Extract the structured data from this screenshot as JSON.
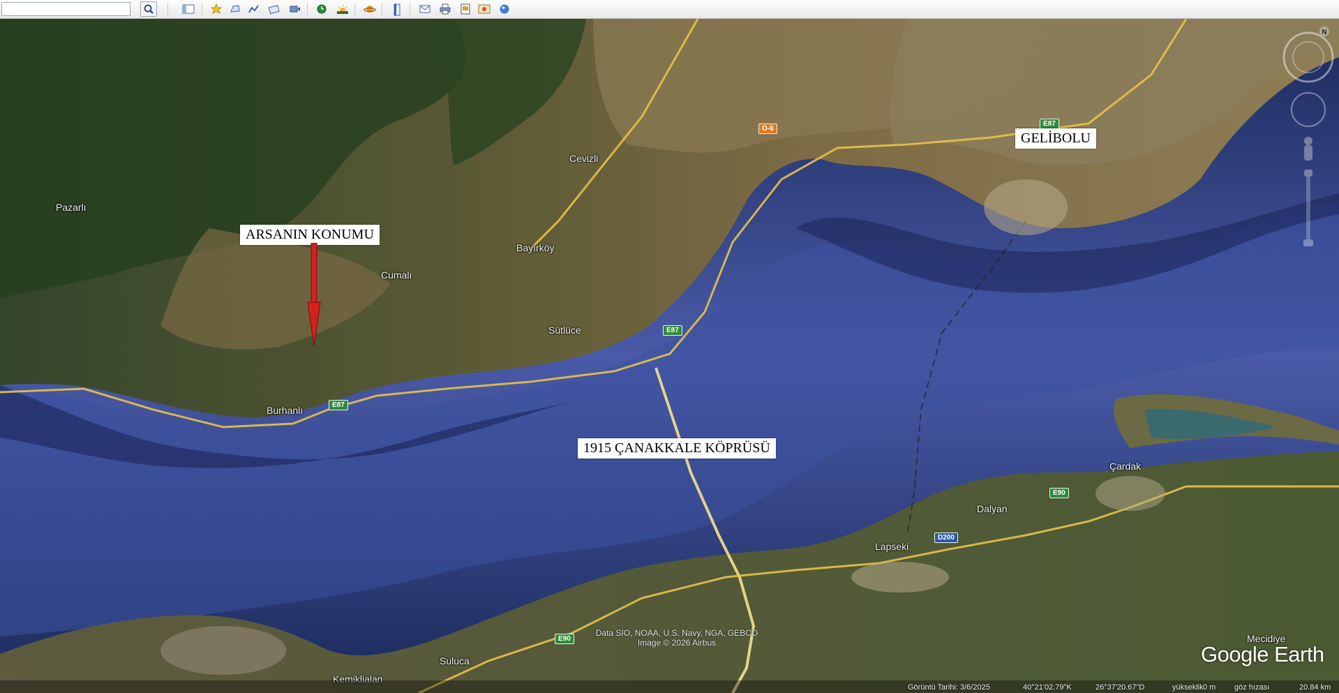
{
  "toolbar": {
    "search_value": "",
    "buttons": [
      "search-icon",
      "sidebar-icon",
      "placemark-icon",
      "polygon-icon",
      "path-icon",
      "image-overlay-icon",
      "record-tour-icon",
      "historical-imagery-icon",
      "sunlight-icon",
      "planets-icon",
      "ruler-icon",
      "email-icon",
      "print-icon",
      "save-image-icon",
      "view-in-maps-icon",
      "earth-icon"
    ]
  },
  "map": {
    "places": {
      "cevizli": "Cevizli",
      "pazarli": "Pazarlı",
      "bayirkoy": "Bayırköy",
      "cumali": "Cumalı",
      "sutluce": "Sütlüce",
      "burhanli": "Burhanlı",
      "cardak": "Çardak",
      "dalyan": "Dalyan",
      "lapseki": "Lapseki",
      "suluca": "Suluca",
      "kemiklialan": "Kemiklialan",
      "mecidiye": "Mecidiye"
    },
    "shields": {
      "o6": "O-6",
      "e87_top": "E87",
      "e87_mid": "E87",
      "e87_left": "E87",
      "e90_right": "E90",
      "d200": "D200",
      "e90_bottom": "E90"
    },
    "callouts": {
      "arsa": "ARSANIN KONUMU",
      "gelibolu": "GELİBOLU",
      "bridge": "1915 ÇANAKKALE KÖPRÜSÜ"
    },
    "arrow_color": "#d62020",
    "water_color": "#3a4f94",
    "attribution": [
      "Data SIO, NOAA, U.S. Navy, NGA, GEBCO",
      "Image © 2026 Airbus"
    ],
    "logo": "Google Earth"
  },
  "status": {
    "date": "Görüntü Tarihi: 3/6/2025",
    "lat": "40°21'02.79\"K",
    "lon": "26°37'20.67\"D",
    "elev_label": "yükseklik",
    "elev_value": "0 m",
    "eye_label": "göz hızası",
    "eye_value": "20.84 km"
  }
}
